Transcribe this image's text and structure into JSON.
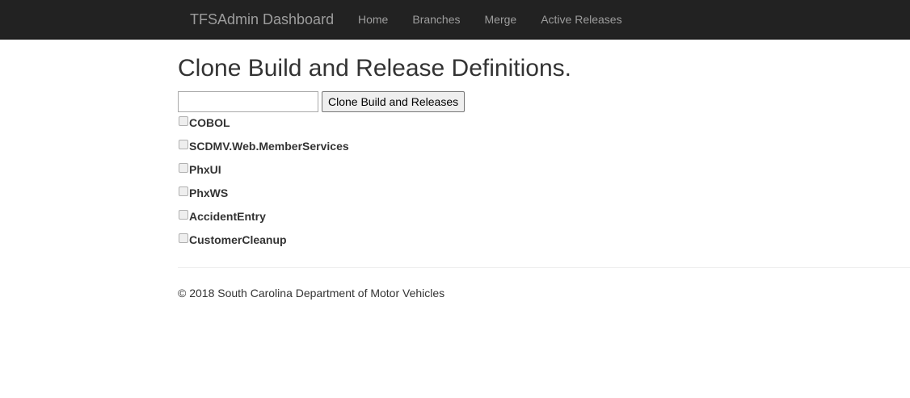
{
  "navbar": {
    "brand": "TFSAdmin Dashboard",
    "links": [
      {
        "label": "Home"
      },
      {
        "label": "Branches"
      },
      {
        "label": "Merge"
      },
      {
        "label": "Active Releases"
      }
    ]
  },
  "main": {
    "title": "Clone Build and Release Definitions.",
    "input": {
      "value": "",
      "placeholder": ""
    },
    "button_label": "Clone Build and Releases",
    "definitions": [
      {
        "label": "COBOL",
        "checked": false
      },
      {
        "label": "SCDMV.Web.MemberServices",
        "checked": false
      },
      {
        "label": "PhxUI",
        "checked": false
      },
      {
        "label": "PhxWS",
        "checked": false
      },
      {
        "label": "AccidentEntry",
        "checked": false
      },
      {
        "label": "CustomerCleanup",
        "checked": false
      }
    ]
  },
  "footer": {
    "text": "© 2018 South Carolina Department of Motor Vehicles"
  },
  "colors": {
    "navbar_bg": "#222222",
    "navbar_text": "#9d9d9d",
    "body_text": "#333333"
  }
}
